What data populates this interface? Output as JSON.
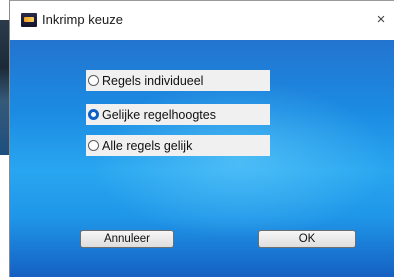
{
  "dialog": {
    "title": "Inkrimp keuze",
    "close_label": "×"
  },
  "options": [
    {
      "label": "Regels individueel",
      "checked": false
    },
    {
      "label": "Gelijke regelhoogtes",
      "checked": true
    },
    {
      "label": "Alle regels gelijk",
      "checked": false
    }
  ],
  "buttons": {
    "cancel_label": "Annuleer",
    "ok_label": "OK"
  },
  "colors": {
    "background_gradient_top": "#2374cf",
    "background_gradient_mid": "#29a6f0",
    "radio_accent": "#0f5fc8"
  }
}
